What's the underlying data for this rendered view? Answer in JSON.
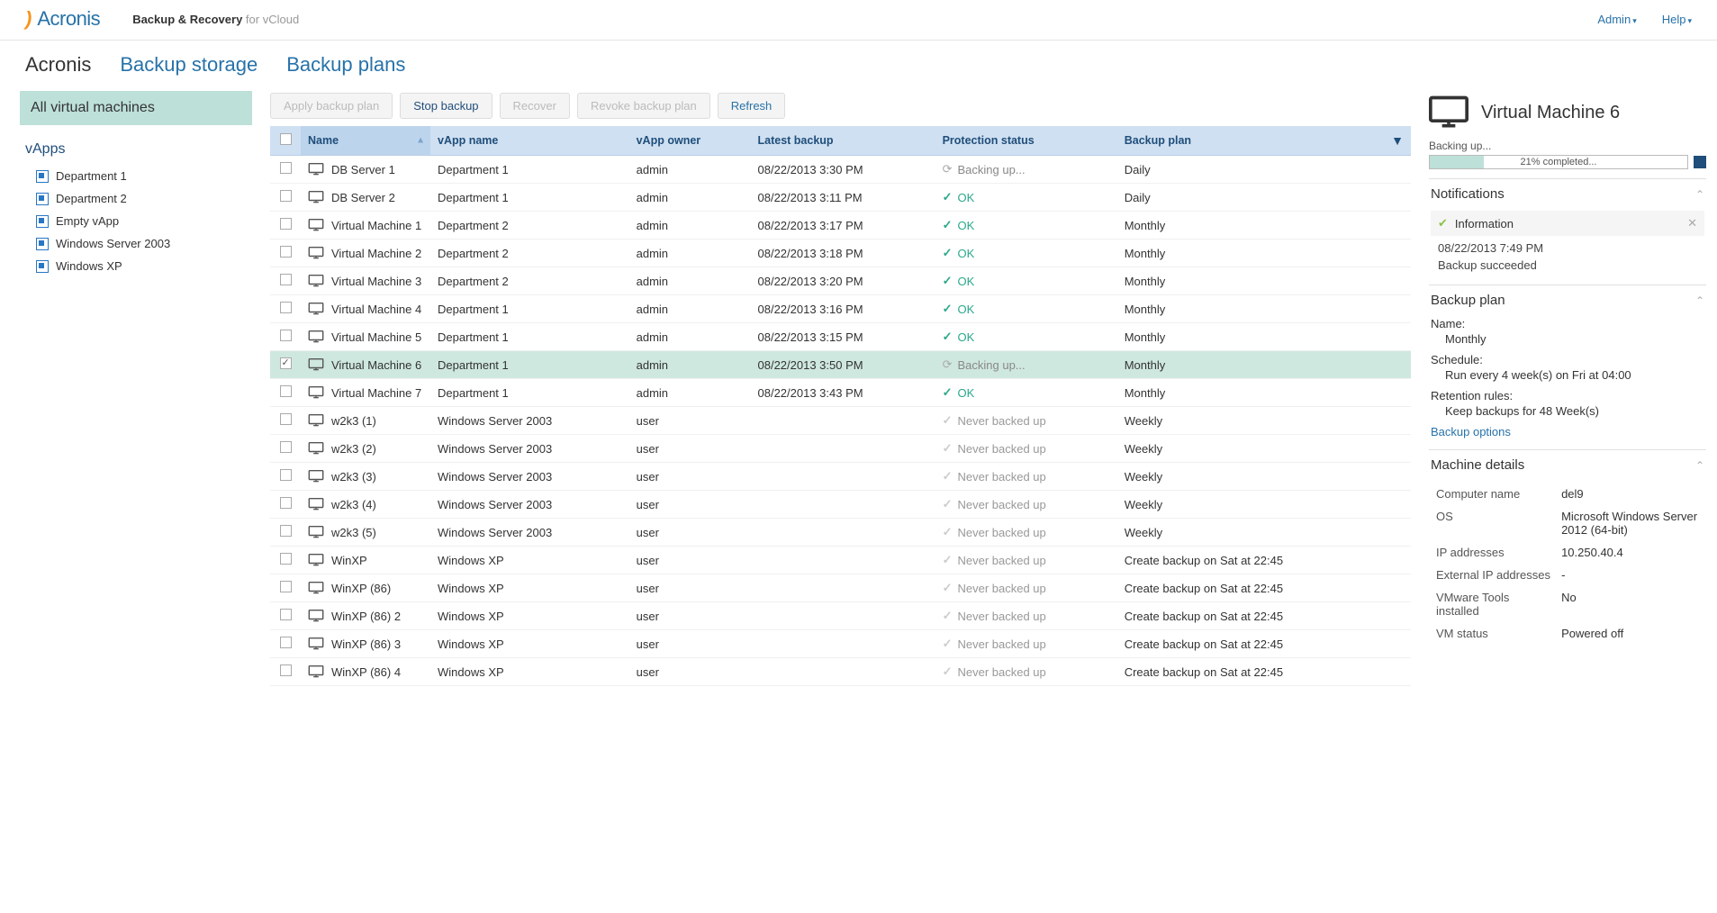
{
  "header": {
    "brand": "Acronis",
    "product_strong": "Backup & Recovery",
    "product_light": " for vCloud",
    "admin": "Admin",
    "help": "Help"
  },
  "mainnav": {
    "items": [
      "Acronis",
      "Backup storage",
      "Backup plans"
    ],
    "active_index": 0
  },
  "sidebar": {
    "header": "All virtual machines",
    "subhead": "vApps",
    "items": [
      {
        "label": "Department 1"
      },
      {
        "label": "Department 2"
      },
      {
        "label": "Empty vApp"
      },
      {
        "label": "Windows Server 2003"
      },
      {
        "label": "Windows XP"
      }
    ]
  },
  "toolbar": {
    "apply": "Apply backup plan",
    "stop": "Stop backup",
    "recover": "Recover",
    "revoke": "Revoke backup plan",
    "refresh": "Refresh"
  },
  "table": {
    "headers": {
      "name": "Name",
      "vapp": "vApp name",
      "owner": "vApp owner",
      "latest": "Latest backup",
      "status": "Protection status",
      "plan": "Backup plan"
    },
    "rows": [
      {
        "checked": false,
        "name": "DB Server 1",
        "vapp": "Department 1",
        "owner": "admin",
        "latest": "08/22/2013 3:30 PM",
        "status": "backing",
        "status_text": "Backing up...",
        "plan": "Daily"
      },
      {
        "checked": false,
        "name": "DB Server 2",
        "vapp": "Department 1",
        "owner": "admin",
        "latest": "08/22/2013 3:11 PM",
        "status": "ok",
        "status_text": "OK",
        "plan": "Daily"
      },
      {
        "checked": false,
        "name": "Virtual Machine 1",
        "vapp": "Department 2",
        "owner": "admin",
        "latest": "08/22/2013 3:17 PM",
        "status": "ok",
        "status_text": "OK",
        "plan": "Monthly"
      },
      {
        "checked": false,
        "name": "Virtual Machine 2",
        "vapp": "Department 2",
        "owner": "admin",
        "latest": "08/22/2013 3:18 PM",
        "status": "ok",
        "status_text": "OK",
        "plan": "Monthly"
      },
      {
        "checked": false,
        "name": "Virtual Machine 3",
        "vapp": "Department 2",
        "owner": "admin",
        "latest": "08/22/2013 3:20 PM",
        "status": "ok",
        "status_text": "OK",
        "plan": "Monthly"
      },
      {
        "checked": false,
        "name": "Virtual Machine 4",
        "vapp": "Department 1",
        "owner": "admin",
        "latest": "08/22/2013 3:16 PM",
        "status": "ok",
        "status_text": "OK",
        "plan": "Monthly"
      },
      {
        "checked": false,
        "name": "Virtual Machine 5",
        "vapp": "Department 1",
        "owner": "admin",
        "latest": "08/22/2013 3:15 PM",
        "status": "ok",
        "status_text": "OK",
        "plan": "Monthly"
      },
      {
        "checked": true,
        "selected": true,
        "name": "Virtual Machine 6",
        "vapp": "Department 1",
        "owner": "admin",
        "latest": "08/22/2013 3:50 PM",
        "status": "backing",
        "status_text": "Backing up...",
        "plan": "Monthly"
      },
      {
        "checked": false,
        "name": "Virtual Machine 7",
        "vapp": "Department 1",
        "owner": "admin",
        "latest": "08/22/2013 3:43 PM",
        "status": "ok",
        "status_text": "OK",
        "plan": "Monthly"
      },
      {
        "checked": false,
        "name": "w2k3 (1)",
        "vapp": "Windows Server 2003",
        "owner": "user",
        "latest": "",
        "status": "never",
        "status_text": "Never backed up",
        "plan": "Weekly"
      },
      {
        "checked": false,
        "name": "w2k3 (2)",
        "vapp": "Windows Server 2003",
        "owner": "user",
        "latest": "",
        "status": "never",
        "status_text": "Never backed up",
        "plan": "Weekly"
      },
      {
        "checked": false,
        "name": "w2k3 (3)",
        "vapp": "Windows Server 2003",
        "owner": "user",
        "latest": "",
        "status": "never",
        "status_text": "Never backed up",
        "plan": "Weekly"
      },
      {
        "checked": false,
        "name": "w2k3 (4)",
        "vapp": "Windows Server 2003",
        "owner": "user",
        "latest": "",
        "status": "never",
        "status_text": "Never backed up",
        "plan": "Weekly"
      },
      {
        "checked": false,
        "name": "w2k3 (5)",
        "vapp": "Windows Server 2003",
        "owner": "user",
        "latest": "",
        "status": "never",
        "status_text": "Never backed up",
        "plan": "Weekly"
      },
      {
        "checked": false,
        "name": "WinXP",
        "vapp": "Windows XP",
        "owner": "user",
        "latest": "",
        "status": "never",
        "status_text": "Never backed up",
        "plan": "Create backup on Sat at 22:45"
      },
      {
        "checked": false,
        "name": "WinXP (86)",
        "vapp": "Windows XP",
        "owner": "user",
        "latest": "",
        "status": "never",
        "status_text": "Never backed up",
        "plan": "Create backup on Sat at 22:45"
      },
      {
        "checked": false,
        "name": "WinXP (86) 2",
        "vapp": "Windows XP",
        "owner": "user",
        "latest": "",
        "status": "never",
        "status_text": "Never backed up",
        "plan": "Create backup on Sat at 22:45"
      },
      {
        "checked": false,
        "name": "WinXP (86) 3",
        "vapp": "Windows XP",
        "owner": "user",
        "latest": "",
        "status": "never",
        "status_text": "Never backed up",
        "plan": "Create backup on Sat at 22:45"
      },
      {
        "checked": false,
        "name": "WinXP (86) 4",
        "vapp": "Windows XP",
        "owner": "user",
        "latest": "",
        "status": "never",
        "status_text": "Never backed up",
        "plan": "Create backup on Sat at 22:45"
      }
    ]
  },
  "details": {
    "title": "Virtual Machine 6",
    "status_label": "Backing up...",
    "progress_percent": 21,
    "progress_text": "21% completed...",
    "notifications": {
      "title": "Notifications",
      "type": "Information",
      "time": "08/22/2013 7:49 PM",
      "message": "Backup succeeded"
    },
    "backup_plan": {
      "title": "Backup plan",
      "name_k": "Name:",
      "name_v": "Monthly",
      "schedule_k": "Schedule:",
      "schedule_v": "Run every 4 week(s) on Fri at 04:00",
      "retention_k": "Retention rules:",
      "retention_v": "Keep backups for 48 Week(s)",
      "options_link": "Backup options"
    },
    "machine": {
      "title": "Machine details",
      "rows": [
        {
          "k": "Computer name",
          "v": "del9"
        },
        {
          "k": "OS",
          "v": "Microsoft Windows Server 2012 (64-bit)"
        },
        {
          "k": "IP addresses",
          "v": "10.250.40.4"
        },
        {
          "k": "External IP addresses",
          "v": "-"
        },
        {
          "k": "VMware Tools installed",
          "v": "No"
        },
        {
          "k": "VM status",
          "v": "Powered off"
        }
      ]
    }
  }
}
